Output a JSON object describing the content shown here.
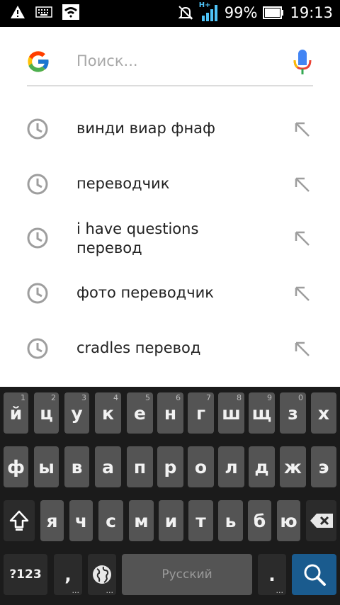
{
  "status_bar": {
    "battery": "99%",
    "time": "19:13",
    "network_label": "H+",
    "icons": [
      "warning-icon",
      "keyboard-icon",
      "wifi-icon",
      "mute-icon",
      "signal-icon",
      "battery-icon"
    ]
  },
  "search": {
    "placeholder": "Поиск...",
    "value": ""
  },
  "suggestions": [
    {
      "line1": "винди виар фнаф",
      "line2": ""
    },
    {
      "line1": "переводчик",
      "line2": ""
    },
    {
      "line1": "i have questions",
      "line2": "перевод"
    },
    {
      "line1": "фото переводчик",
      "line2": ""
    },
    {
      "line1": "cradles перевод",
      "line2": ""
    }
  ],
  "keyboard": {
    "row1": [
      "й",
      "ц",
      "у",
      "к",
      "е",
      "н",
      "г",
      "ш",
      "щ",
      "з",
      "х"
    ],
    "row1_hints": [
      "1",
      "2",
      "3",
      "4",
      "5",
      "6",
      "7",
      "8",
      "9",
      "0",
      ""
    ],
    "row2": [
      "ф",
      "ы",
      "в",
      "а",
      "п",
      "р",
      "о",
      "л",
      "д",
      "ж",
      "э"
    ],
    "row3": [
      "я",
      "ч",
      "с",
      "м",
      "и",
      "т",
      "ь",
      "б",
      "ю"
    ],
    "symbols_label": "?123",
    "comma": ",",
    "space_label": "Русский",
    "period": ".",
    "dots": "..."
  },
  "colors": {
    "accent": "#1a5b8e",
    "key_bg": "#545454",
    "keyboard_bg": "#1b1b1b"
  }
}
